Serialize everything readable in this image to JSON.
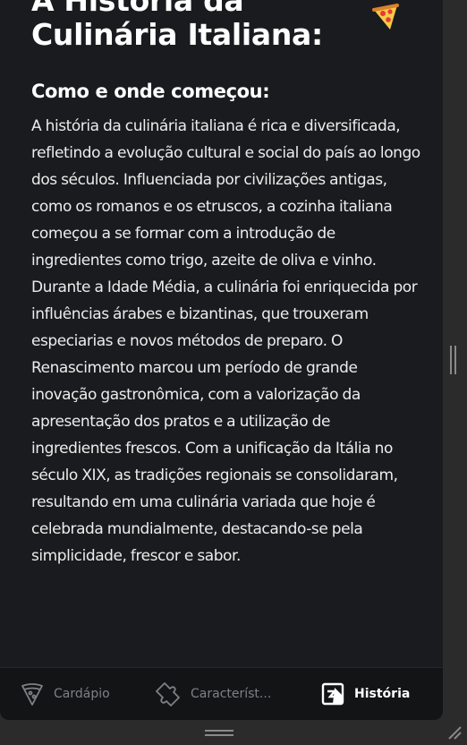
{
  "article": {
    "title": "A História da Culinária Italiana:",
    "title_icon": "pizza-icon",
    "subtitle": "Como e onde começou:",
    "body": "A história da culinária italiana é rica e diversificada, refletindo a evolução cultural e social do país ao longo dos séculos. Influenciada por civilizações antigas, como os romanos e os etruscos, a cozinha italiana começou a se formar com a introdução de ingredientes como trigo, azeite de oliva e vinho. Durante a Idade Média, a culinária foi enriquecida por influências árabes e bizantinas, que trouxeram especiarias e novos métodos de preparo. O Renascimento marcou um período de grande inovação gastronômica, com a valorização da apresentação dos pratos e a utilização de ingredientes frescos. Com a unificação da Itália no século XIX, as tradições regionais se consolidaram, resultando em uma culinária variada que hoje é celebrada mundialmente, destacando-se pela simplicidade, frescor e sabor."
  },
  "tabs": [
    {
      "label": "Cardápio",
      "icon": "pizza-slice-icon",
      "active": false
    },
    {
      "label": "Característ...",
      "icon": "puzzle-icon",
      "active": false
    },
    {
      "label": "História",
      "icon": "history-icon",
      "active": true
    }
  ],
  "colors": {
    "background": "#1a1b1e",
    "tabbar": "#131416",
    "text": "#ececec",
    "inactive_tab": "#7f8084",
    "active_tab": "#ffffff"
  }
}
